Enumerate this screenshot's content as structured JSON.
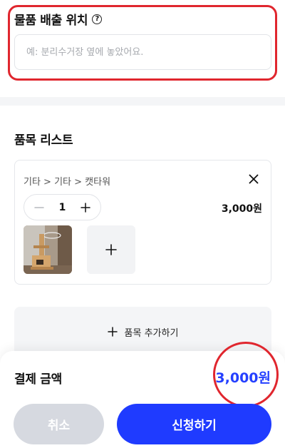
{
  "location": {
    "title": "물품 배출 위치",
    "help_icon": "question-circle-icon",
    "help_glyph": "?",
    "placeholder": "예: 분리수거장 옆에 놓았어요.",
    "value": ""
  },
  "item_list": {
    "title": "품목 리스트",
    "items": [
      {
        "category": "기타 > 기타 > 캣타워",
        "quantity": "1",
        "price": "3,000원"
      }
    ],
    "add_item_label": "품목 추가하기"
  },
  "summary": {
    "total_label": "결제 금액",
    "total_amount": "3,000원"
  },
  "actions": {
    "cancel_label": "취소",
    "apply_label": "신청하기"
  },
  "colors": {
    "accent": "#1f3bff",
    "amount": "#2540ff",
    "annotation": "#e0262e",
    "cancel_bg": "#d6d9e0"
  }
}
